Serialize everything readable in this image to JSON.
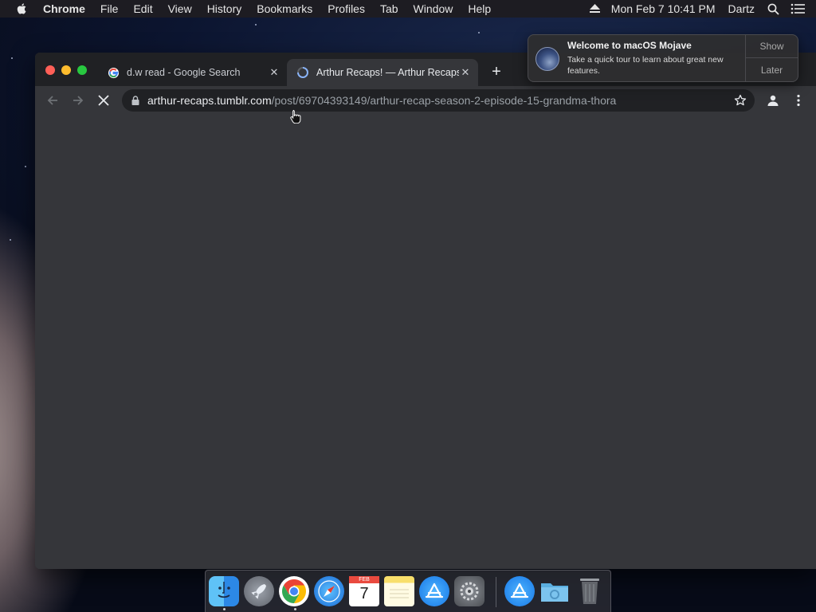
{
  "menubar": {
    "app_name": "Chrome",
    "menus": [
      "File",
      "Edit",
      "View",
      "History",
      "Bookmarks",
      "Profiles",
      "Tab",
      "Window",
      "Help"
    ],
    "clock": "Mon Feb 7  10:41 PM",
    "user": "Dartz"
  },
  "browser": {
    "tabs": [
      {
        "title": "d.w read - Google Search",
        "favicon": "google-g-icon",
        "active": false
      },
      {
        "title": "Arthur Recaps! — Arthur Recaps",
        "favicon": "loading-spinner-icon",
        "active": true
      }
    ],
    "url_host": "arthur-recaps.tumblr.com",
    "url_path": "/post/69704393149/arthur-recap-season-2-episode-15-grandma-thora"
  },
  "notification": {
    "title": "Welcome to macOS Mojave",
    "body": "Take a quick tour to learn about great new features.",
    "show_label": "Show",
    "later_label": "Later"
  },
  "dock": {
    "apps": [
      "Finder",
      "Launchpad",
      "Google Chrome",
      "Safari",
      "Calendar",
      "Notes",
      "App Store",
      "System Preferences"
    ],
    "others": [
      "App Store Downloads",
      "Folder",
      "Trash"
    ],
    "calendar_month": "FEB",
    "calendar_day": "7"
  },
  "colors": {
    "window_bg": "#35363a",
    "tabstrip_bg": "#202124",
    "omnibox_bg": "#202124",
    "close_red": "#ff5f57",
    "minimize_yellow": "#febc2e",
    "zoom_green": "#28c840"
  }
}
